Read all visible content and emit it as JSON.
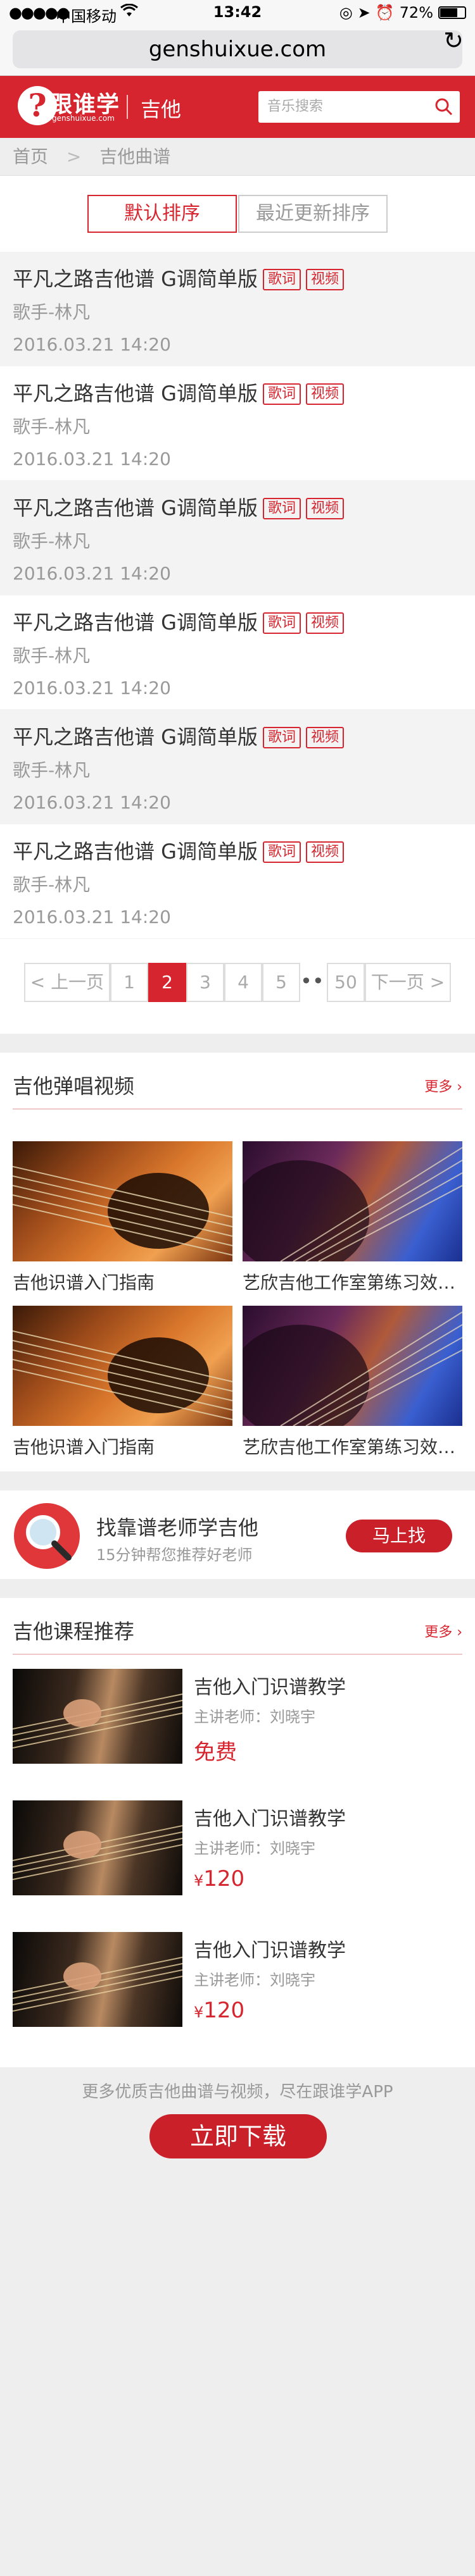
{
  "status_bar": {
    "carrier": "中国移动",
    "time": "13:42",
    "battery": "72%",
    "battery_level": 0.72
  },
  "browser": {
    "url": "genshuixue.com",
    "reload_icon": "reload-icon"
  },
  "header": {
    "logo_text": "跟谁学",
    "logo_sub": "genshuixue.com",
    "category": "吉他",
    "search_placeholder": "音乐搜索",
    "brand_color": "#d6252e"
  },
  "breadcrumb": {
    "home": "首页",
    "current": "吉他曲谱"
  },
  "sort_tabs": [
    {
      "label": "默认排序",
      "active": true
    },
    {
      "label": "最近更新排序",
      "active": false
    }
  ],
  "songs": [
    {
      "title": "平凡之路吉他谱 G调简单版",
      "lyrics_badge": "歌词",
      "video_badge": "视频",
      "singer": "歌手-林凡",
      "date": "2016.03.21  14:20"
    },
    {
      "title": "平凡之路吉他谱 G调简单版",
      "lyrics_badge": "歌词",
      "video_badge": "视频",
      "singer": "歌手-林凡",
      "date": "2016.03.21  14:20"
    },
    {
      "title": "平凡之路吉他谱 G调简单版",
      "lyrics_badge": "歌词",
      "video_badge": "视频",
      "singer": "歌手-林凡",
      "date": "2016.03.21  14:20"
    },
    {
      "title": "平凡之路吉他谱 G调简单版",
      "lyrics_badge": "歌词",
      "video_badge": "视频",
      "singer": "歌手-林凡",
      "date": "2016.03.21  14:20"
    },
    {
      "title": "平凡之路吉他谱 G调简单版",
      "lyrics_badge": "歌词",
      "video_badge": "视频",
      "singer": "歌手-林凡",
      "date": "2016.03.21  14:20"
    },
    {
      "title": "平凡之路吉他谱 G调简单版",
      "lyrics_badge": "歌词",
      "video_badge": "视频",
      "singer": "歌手-林凡",
      "date": "2016.03.21  14:20"
    }
  ],
  "pagination": {
    "prev": "上一页",
    "next": "下一页",
    "pages": [
      "1",
      "2",
      "3",
      "4",
      "5"
    ],
    "current": "2",
    "ellipsis": "•••",
    "last": "50"
  },
  "videos_section": {
    "title": "吉他弹唱视频",
    "more": "更多",
    "items": [
      {
        "title": "吉他识谱入门指南"
      },
      {
        "title": "艺欣吉他工作室第练习效果展示"
      },
      {
        "title": "吉他识谱入门指南"
      },
      {
        "title": "艺欣吉他工作室第练习效果展示"
      }
    ]
  },
  "teacher_banner": {
    "title": "找靠谱老师学吉他",
    "subtitle": "15分钟帮您推荐好老师",
    "button": "马上找"
  },
  "courses_section": {
    "title": "吉他课程推荐",
    "more": "更多",
    "items": [
      {
        "title": "吉他入门识谱教学",
        "teacher": "主讲老师：刘晓宇",
        "price": "免费",
        "currency": ""
      },
      {
        "title": "吉他入门识谱教学",
        "teacher": "主讲老师：刘晓宇",
        "price": "120",
        "currency": "¥"
      },
      {
        "title": "吉他入门识谱教学",
        "teacher": "主讲老师：刘晓宇",
        "price": "120",
        "currency": "¥"
      }
    ]
  },
  "footer": {
    "text": "更多优质吉他曲谱与视频，尽在跟谁学APP",
    "button": "立即下载"
  }
}
